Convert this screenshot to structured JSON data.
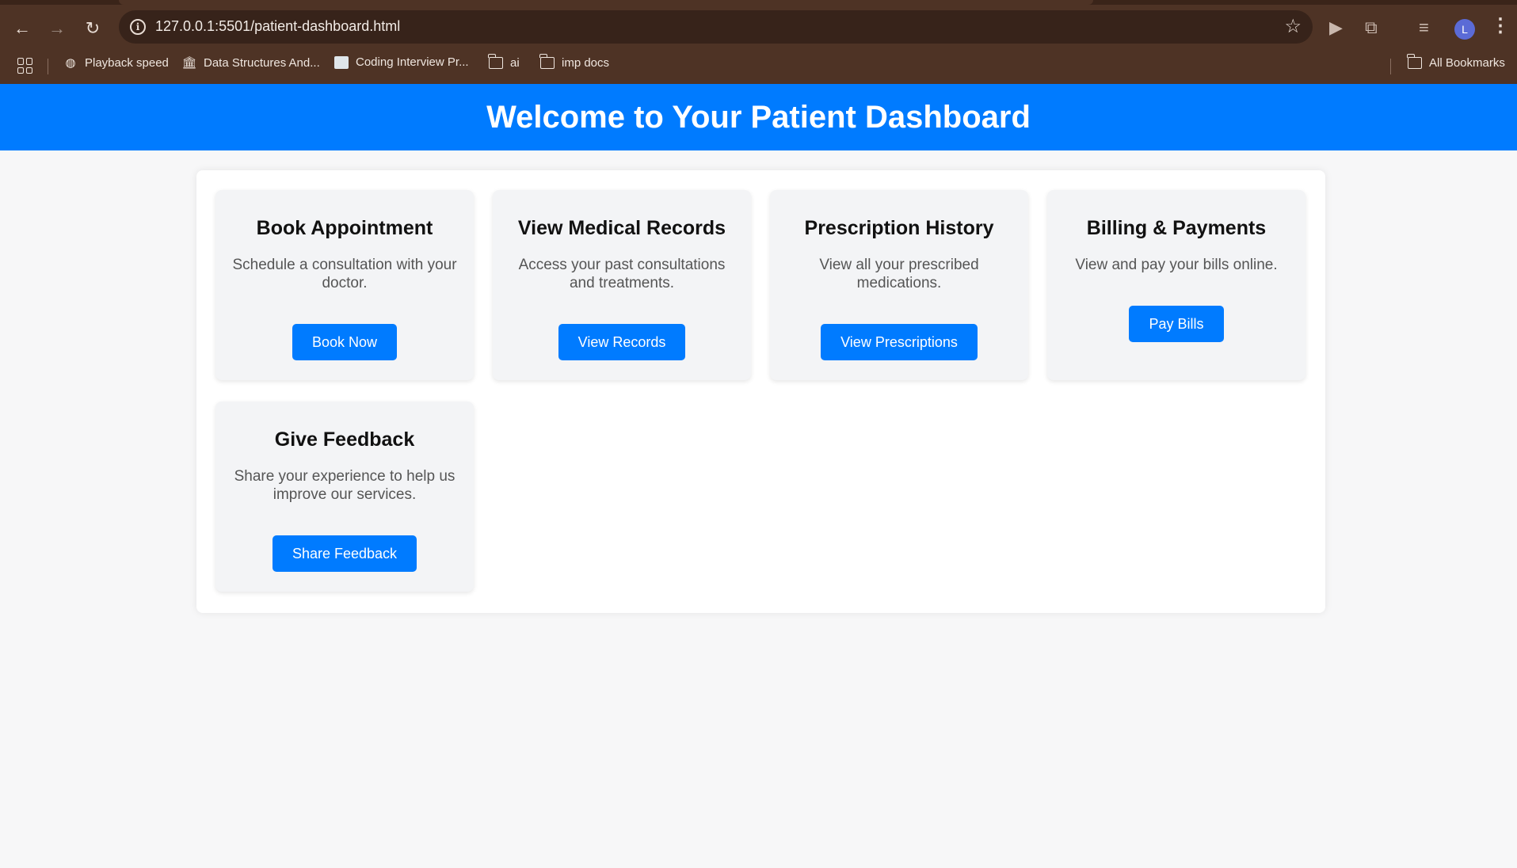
{
  "browser": {
    "url": "127.0.0.1:5501/patient-dashboard.html",
    "avatar_letter": "L",
    "bookmarks": [
      {
        "label": "Playback speed",
        "icon": "globe-icon"
      },
      {
        "label": "Data Structures And...",
        "icon": "column-building-icon"
      },
      {
        "label": "Coding Interview Pr...",
        "icon": "site-favicon"
      },
      {
        "label": "ai",
        "icon": "folder-icon"
      },
      {
        "label": "imp docs",
        "icon": "folder-icon"
      }
    ],
    "all_bookmarks": "All Bookmarks"
  },
  "page": {
    "title": "Welcome to Your Patient Dashboard",
    "accent_color": "#007bff",
    "cards": [
      {
        "title": "Book Appointment",
        "description": "Schedule a consultation with your doctor.",
        "button": "Book Now"
      },
      {
        "title": "View Medical Records",
        "description": "Access your past consultations and treatments.",
        "button": "View Records"
      },
      {
        "title": "Prescription History",
        "description": "View all your prescribed medications.",
        "button": "View Prescriptions"
      },
      {
        "title": "Billing & Payments",
        "description": "View and pay your bills online.",
        "button": "Pay Bills"
      },
      {
        "title": "Give Feedback",
        "description": "Share your experience to help us improve our services.",
        "button": "Share Feedback"
      }
    ]
  }
}
